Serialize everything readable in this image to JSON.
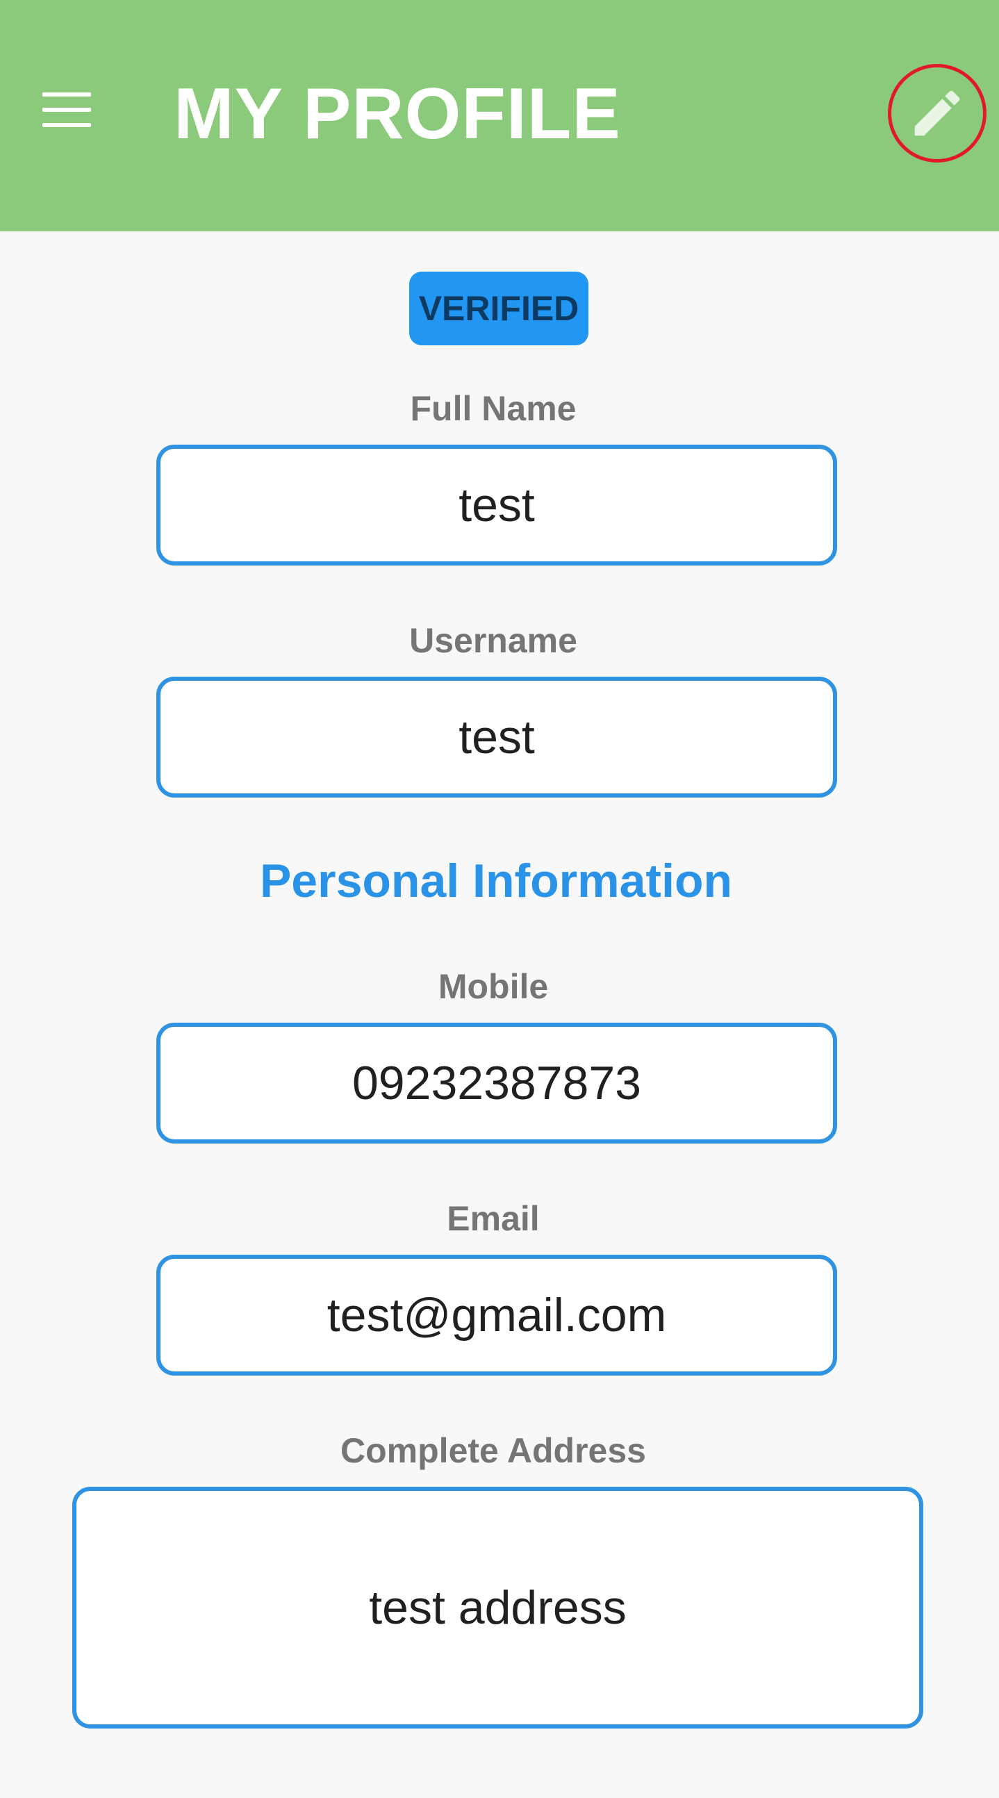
{
  "app_bar": {
    "title": "MY PROFILE",
    "menu_icon": "hamburger-menu-icon",
    "edit_icon": "pencil-icon",
    "background_color": "#8bca7a"
  },
  "badge": {
    "label": "VERIFIED",
    "color": "#2196f3"
  },
  "fields": {
    "full_name": {
      "label": "Full Name",
      "value": "test"
    },
    "username": {
      "label": "Username",
      "value": "test"
    },
    "mobile": {
      "label": "Mobile",
      "value": "09232387873"
    },
    "email": {
      "label": "Email",
      "value": "test@gmail.com"
    },
    "address": {
      "label": "Complete Address",
      "value": "test address"
    }
  },
  "section": {
    "personal_info_heading": "Personal Information"
  },
  "colors": {
    "field_border": "#2f93e2",
    "heading_accent": "#2a93e8",
    "highlight_ring": "#e1192a"
  }
}
